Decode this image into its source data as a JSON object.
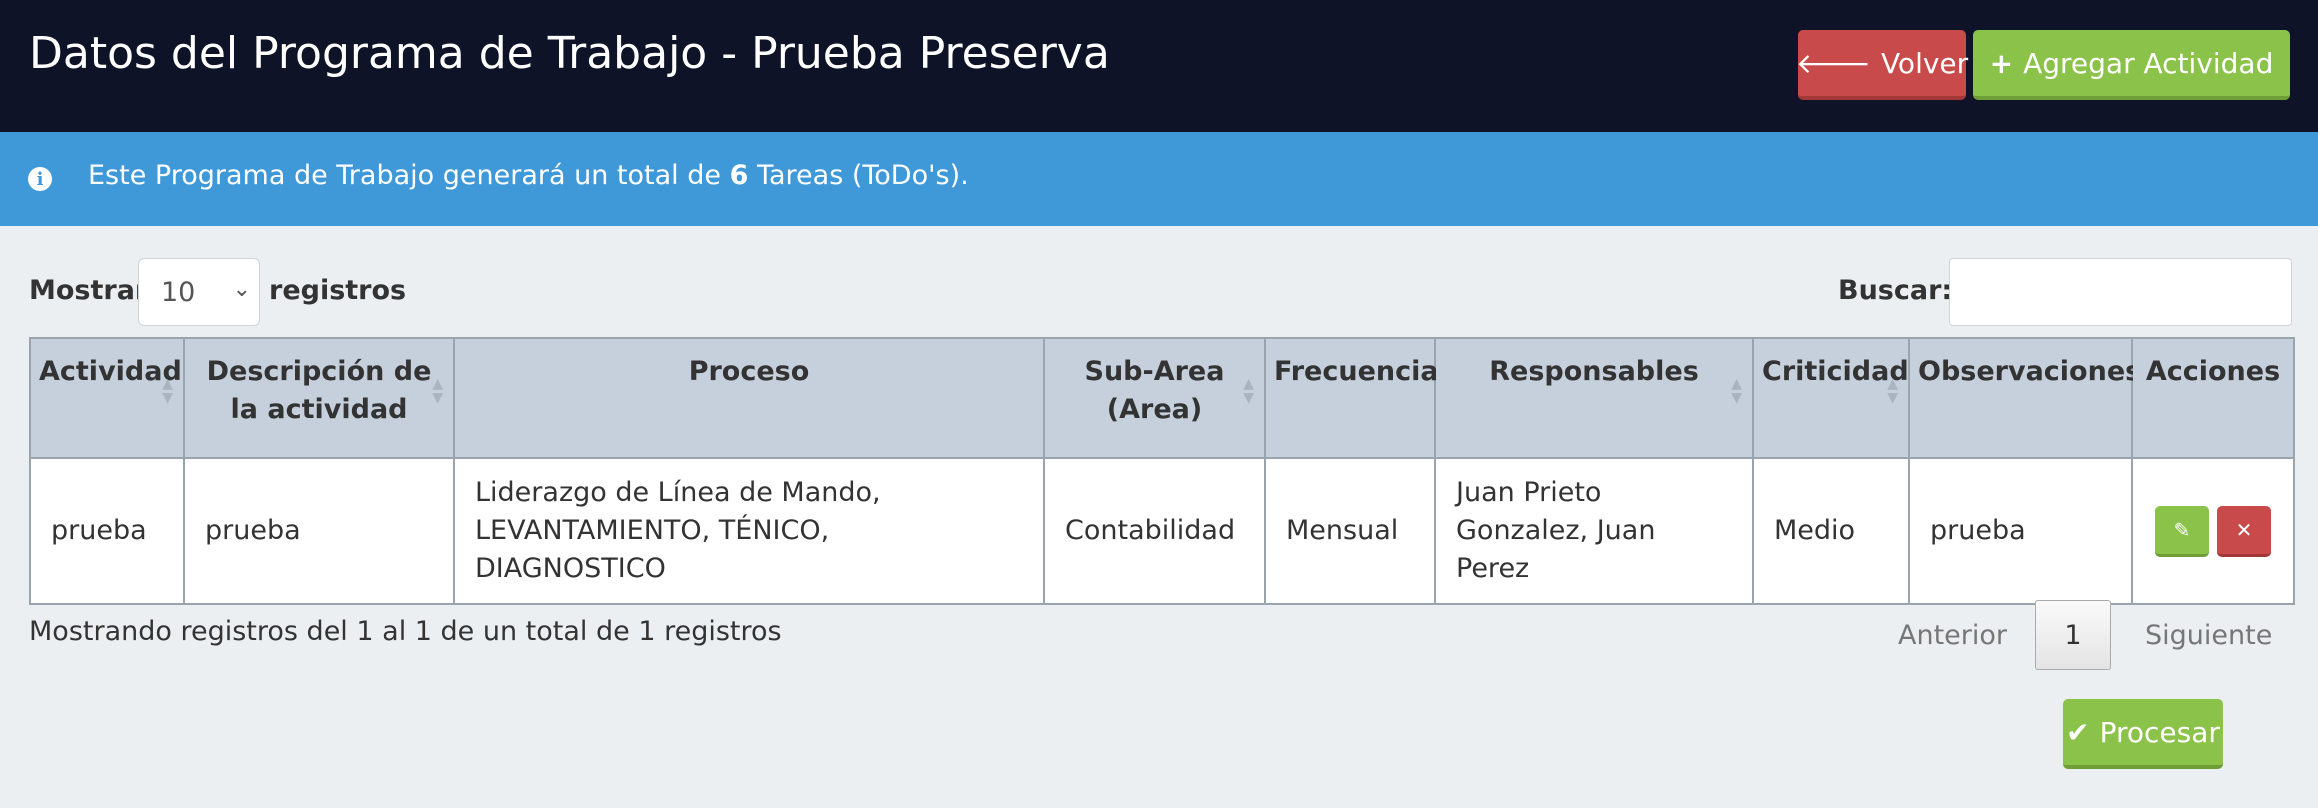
{
  "header": {
    "title": "Datos del Programa de Trabajo - Prueba Preserva",
    "back_label": "Volver",
    "add_label": "Agregar Actividad"
  },
  "info": {
    "prefix": "Este Programa de Trabajo generará un total de",
    "count": "6",
    "suffix": "Tareas (ToDo's)."
  },
  "length": {
    "label_before": "Mostrar",
    "value": "10",
    "label_after": "registros"
  },
  "search": {
    "label": "Buscar:",
    "value": ""
  },
  "table": {
    "headers": [
      "Actividad",
      "Descripción de la actividad",
      "Proceso",
      "Sub-Area (Area)",
      "Frecuencia",
      "Responsables",
      "Criticidad",
      "Observaciones",
      "Acciones"
    ],
    "rows": [
      {
        "actividad": "prueba",
        "descripcion": "prueba",
        "proceso": "Liderazgo de Línea de Mando, LEVANTAMIENTO, TÉNICO, DIAGNOSTICO",
        "subarea": "Contabilidad",
        "frecuencia": "Mensual",
        "responsables": "Juan Prieto Gonzalez, Juan Perez",
        "criticidad": "Medio",
        "observaciones": "prueba"
      }
    ]
  },
  "footer": {
    "info": "Mostrando registros del 1 al 1 de un total de 1 registros",
    "prev": "Anterior",
    "page": "1",
    "next": "Siguiente",
    "process_label": "Procesar"
  },
  "icons": {
    "back": "arrow-left-icon",
    "add": "plus-icon",
    "info": "info-circle-icon",
    "edit": "pencil-icon",
    "delete": "times-icon",
    "process": "check-icon"
  },
  "colors": {
    "header_bg": "#0e1328",
    "info_bg": "#3f98d8",
    "danger": "#c94a4a",
    "success": "#8bc34a",
    "table_header_bg": "#c5d0dc"
  }
}
